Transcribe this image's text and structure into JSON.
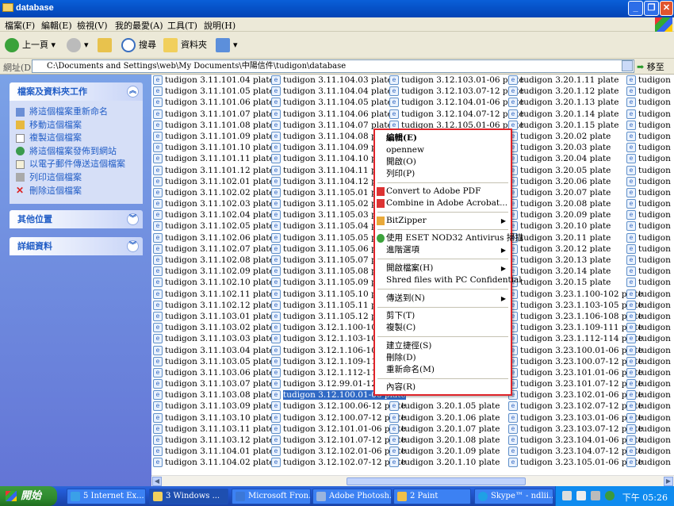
{
  "window": {
    "title": "database"
  },
  "menu": [
    "檔案(F)",
    "編輯(E)",
    "檢視(V)",
    "我的最愛(A)",
    "工具(T)",
    "說明(H)"
  ],
  "toolbar": {
    "back": "上一頁",
    "search": "搜尋",
    "folders": "資料夾"
  },
  "address": {
    "label": "網址(D)",
    "path": "C:\\Documents and Settings\\web\\My Documents\\中陽信件\\tudigon\\database",
    "go": "移至"
  },
  "sidebar": {
    "tasks_title": "檔案及資料夾工作",
    "tasks": [
      "將這個檔案重新命名",
      "移動這個檔案",
      "複製這個檔案",
      "將這個檔案發佈到網站",
      "以電子郵件傳送這個檔案",
      "列印這個檔案",
      "刪除這個檔案"
    ],
    "other_title": "其他位置",
    "details_title": "詳細資料"
  },
  "files": {
    "col1": [
      "tudigon 3.11.101.04 plate",
      "tudigon 3.11.101.05 plate",
      "tudigon 3.11.101.06 plate",
      "tudigon 3.11.101.07 plate",
      "tudigon 3.11.101.08 plate",
      "tudigon 3.11.101.09 plate",
      "tudigon 3.11.101.10 plate",
      "tudigon 3.11.101.11 plate",
      "tudigon 3.11.101.12 plate",
      "tudigon 3.11.102.01 plate",
      "tudigon 3.11.102.02 plate",
      "tudigon 3.11.102.03 plate",
      "tudigon 3.11.102.04 plate",
      "tudigon 3.11.102.05 plate",
      "tudigon 3.11.102.06 plate",
      "tudigon 3.11.102.07 plate",
      "tudigon 3.11.102.08 plate",
      "tudigon 3.11.102.09 plate",
      "tudigon 3.11.102.10 plate",
      "tudigon 3.11.102.11 plate",
      "tudigon 3.11.102.12 plate",
      "tudigon 3.11.103.01 plate",
      "tudigon 3.11.103.02 plate",
      "tudigon 3.11.103.03 plate",
      "tudigon 3.11.103.04 plate",
      "tudigon 3.11.103.05 plate",
      "tudigon 3.11.103.06 plate",
      "tudigon 3.11.103.07 plate",
      "tudigon 3.11.103.08 plate",
      "tudigon 3.11.103.09 plate",
      "tudigon 3.11.103.10 plate",
      "tudigon 3.11.103.11 plate",
      "tudigon 3.11.103.12 plate",
      "tudigon 3.11.104.01 plate",
      "tudigon 3.11.104.02 plate"
    ],
    "col2": [
      "tudigon 3.11.104.03 plate",
      "tudigon 3.11.104.04 plate",
      "tudigon 3.11.104.05 plate",
      "tudigon 3.11.104.06 plate",
      "tudigon 3.11.104.07 plate",
      "tudigon 3.11.104.08 plate",
      "tudigon 3.11.104.09 plate",
      "tudigon 3.11.104.10 plate",
      "tudigon 3.11.104.11 plate",
      "tudigon 3.11.104.12 plate",
      "tudigon 3.11.105.01 plate",
      "tudigon 3.11.105.02 plate",
      "tudigon 3.11.105.03 plate",
      "tudigon 3.11.105.04 plate",
      "tudigon 3.11.105.05 plate",
      "tudigon 3.11.105.06 plate",
      "tudigon 3.11.105.07 plate",
      "tudigon 3.11.105.08 plate",
      "tudigon 3.11.105.09 plate",
      "tudigon 3.11.105.10 plate",
      "tudigon 3.11.105.11 plate",
      "tudigon 3.11.105.12 plate",
      "tudigon 3.12.1.100-102 plate",
      "tudigon 3.12.1.103-105 plate",
      "tudigon 3.12.1.106-108 plate",
      "tudigon 3.12.1.109-111 plate",
      "tudigon 3.12.1.112-114 plate",
      "tudigon 3.12.99.01-12 plate",
      "tudigon 3.12.100.01-06 plate",
      "tudigon 3.12.100.06-12 plate",
      "tudigon 3.12.100.07-12 plate",
      "tudigon 3.12.101.01-06 plate",
      "tudigon 3.12.101.07-12 plate",
      "tudigon 3.12.102.01-06 plate",
      "tudigon 3.12.102.07-12 plate"
    ],
    "col3": [
      "tudigon 3.12.103.01-06 plate",
      "tudigon 3.12.103.07-12 plate",
      "tudigon 3.12.104.01-06 plate",
      "tudigon 3.12.104.07-12 plate",
      "tudigon 3.12.105.01-06 plate",
      "",
      "",
      "",
      "",
      "",
      "",
      "",
      "",
      "",
      "",
      "",
      "",
      "",
      "",
      "",
      "",
      "",
      "",
      "",
      "",
      "",
      "",
      "",
      "",
      "tudigon 3.20.1.05 plate",
      "tudigon 3.20.1.06 plate",
      "tudigon 3.20.1.07 plate",
      "tudigon 3.20.1.08 plate",
      "tudigon 3.20.1.09 plate",
      "tudigon 3.20.1.10 plate"
    ],
    "col4": [
      "tudigon 3.20.1.11 plate",
      "tudigon 3.20.1.12 plate",
      "tudigon 3.20.1.13 plate",
      "tudigon 3.20.1.14 plate",
      "tudigon 3.20.1.15 plate",
      "tudigon 3.20.02 plate",
      "tudigon 3.20.03 plate",
      "tudigon 3.20.04 plate",
      "tudigon 3.20.05 plate",
      "tudigon 3.20.06 plate",
      "tudigon 3.20.07 plate",
      "tudigon 3.20.08 plate",
      "tudigon 3.20.09 plate",
      "tudigon 3.20.10 plate",
      "tudigon 3.20.11 plate",
      "tudigon 3.20.12 plate",
      "tudigon 3.20.13 plate",
      "tudigon 3.20.14 plate",
      "tudigon 3.20.15 plate",
      "tudigon 3.23.1.100-102 plate",
      "tudigon 3.23.1.103-105 plate",
      "tudigon 3.23.1.106-108 plate",
      "tudigon 3.23.1.109-111 plate",
      "tudigon 3.23.1.112-114 plate",
      "tudigon 3.23.100.01-06 plate",
      "tudigon 3.23.100.07-12 plate",
      "tudigon 3.23.101.01-06 plate",
      "tudigon 3.23.101.07-12 plate",
      "tudigon 3.23.102.01-06 plate",
      "tudigon 3.23.102.07-12 plate",
      "tudigon 3.23.103.01-06 plate",
      "tudigon 3.23.103.07-12 plate",
      "tudigon 3.23.104.01-06 plate",
      "tudigon 3.23.104.07-12 plate",
      "tudigon 3.23.105.01-06 plate"
    ],
    "col5": [
      "tudigon 3.2",
      "tudigon 3.2",
      "tudigon 3.2",
      "tudigon 3.2",
      "tudigon 3.2",
      "tudigon 3.2",
      "tudigon 3.2",
      "tudigon 3.2",
      "tudigon 3.2",
      "tudigon 3.2",
      "tudigon 3.2",
      "tudigon 3.2",
      "tudigon 3.2",
      "tudigon 3.2",
      "tudigon 3.2",
      "tudigon 3.2",
      "tudigon 3.2",
      "tudigon 3.2",
      "tudigon 3.2",
      "tudigon 3.2",
      "tudigon 3.2",
      "tudigon 3.2",
      "tudigon 3.2",
      "tudigon 3.2",
      "tudigon 3.2",
      "tudigon 3.2",
      "tudigon 3.2",
      "tudigon 3.2",
      "tudigon 3.2",
      "tudigon 3.2",
      "tudigon 3.2",
      "tudigon 3.2",
      "tudigon 3.2",
      "tudigon 3.2",
      "tudigon 3.2"
    ],
    "selected": "tudigon 3.12.100.01-06 plate"
  },
  "context_menu": {
    "edit": "編輯(E)",
    "opennew": "opennew",
    "open": "開啟(O)",
    "print": "列印(P)",
    "convert_pdf": "Convert to Adobe PDF",
    "combine": "Combine in Adobe Acrobat...",
    "bitzipper": "BitZipper",
    "eset": "使用 ESET NOD32 Antivirus 掃描",
    "advanced": "進階選項",
    "open_file": "開啟檔案(H)",
    "shred": "Shred files with PC Confidential",
    "send_to": "傳送到(N)",
    "cut": "剪下(T)",
    "copy": "複製(C)",
    "shortcut": "建立捷徑(S)",
    "delete": "刪除(D)",
    "rename": "重新命名(M)",
    "properties": "內容(R)"
  },
  "taskbar": {
    "start": "開始",
    "buttons": [
      "5 Internet Ex...",
      "3 Windows ...",
      "Microsoft Fron...",
      "Adobe Photosh...",
      "2 Paint",
      "Skype™ - ndlii..."
    ],
    "clock": "下午 05:26"
  }
}
